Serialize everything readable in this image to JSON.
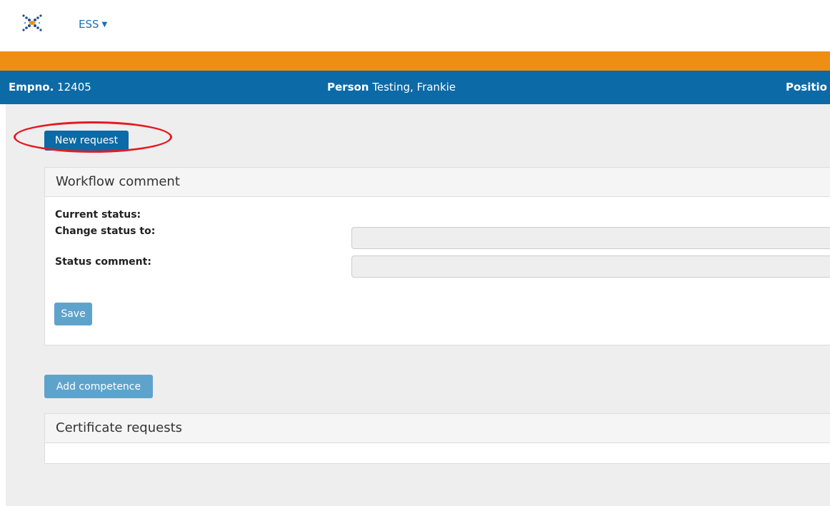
{
  "header": {
    "logo_icon": "cross-dots-logo-icon",
    "menu_label": "ESS",
    "menu_icon": "caret-down-icon",
    "band_color": "#ef8e14"
  },
  "info_bar": {
    "empno_label": "Empno.",
    "empno_value": "12405",
    "person_label": "Person",
    "person_value": "Testing, Frankie",
    "position_label": "Positio",
    "color": "#0c6aa6"
  },
  "actions": {
    "new_request_label": "New request",
    "add_competence_label": "Add competence"
  },
  "workflow": {
    "title": "Workflow comment",
    "current_status_label": "Current status:",
    "change_status_label": "Change status to:",
    "change_status_value": "",
    "status_comment_label": "Status comment:",
    "status_comment_value": "",
    "save_label": "Save"
  },
  "certificates": {
    "title": "Certificate requests"
  }
}
